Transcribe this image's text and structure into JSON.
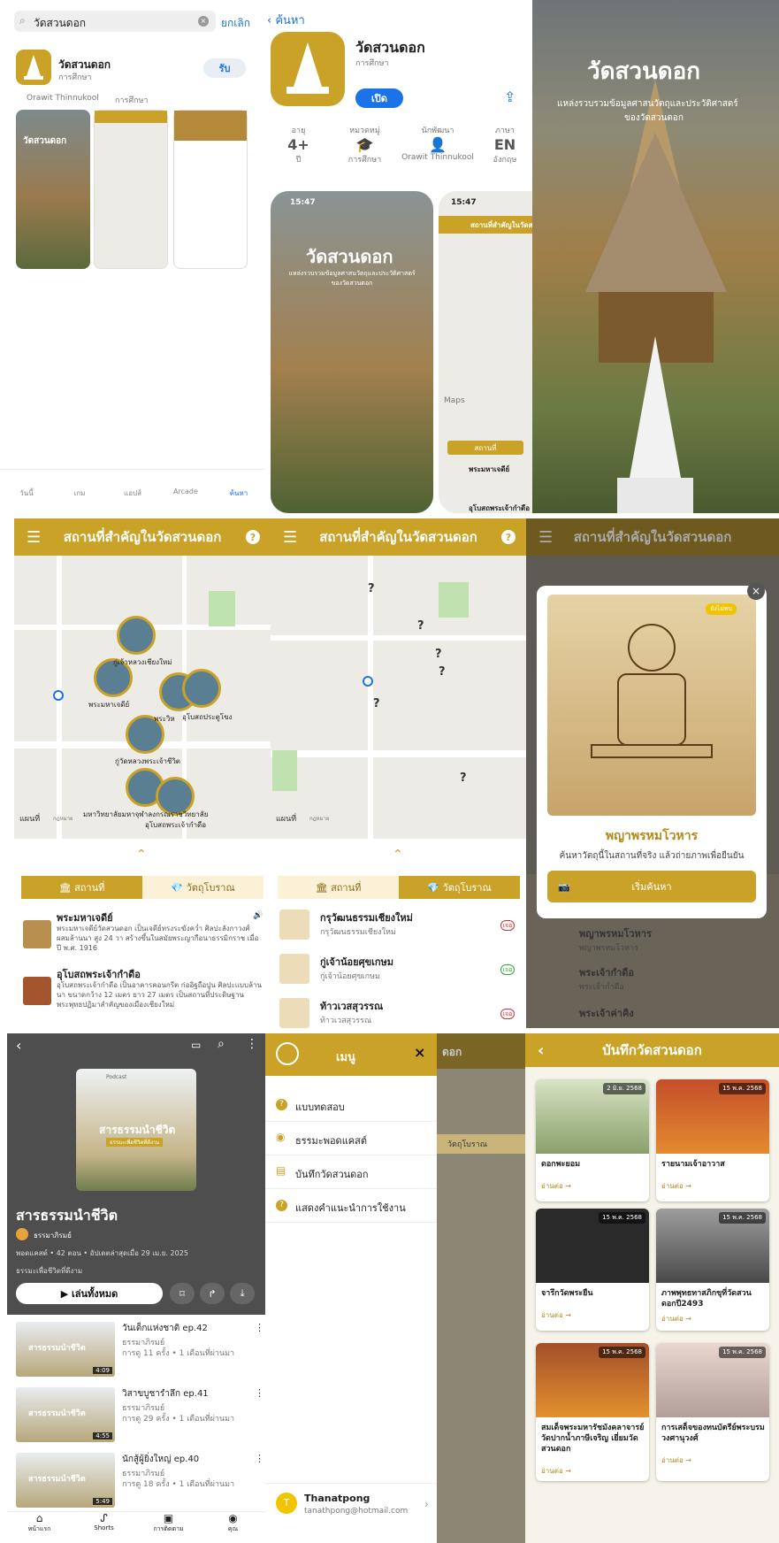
{
  "colors": {
    "gold": "#c9a227",
    "blue": "#1a73e8"
  },
  "p1": {
    "search_value": "วัดสวนดอก",
    "cancel": "ยกเลิก",
    "app_name": "วัดสวนดอก",
    "app_cat": "การศึกษา",
    "get": "รับ",
    "developer": "Orawit Thinnukool",
    "dev_cat": "การศึกษา",
    "tabs": [
      "วันนี้",
      "เกม",
      "แอปส์",
      "Arcade",
      "ค้นหา"
    ],
    "shot1_title": "วัดสวนดอก"
  },
  "p2": {
    "back": "ค้นหา",
    "app_name": "วัดสวนดอก",
    "app_cat": "การศึกษา",
    "open": "เปิด",
    "info": [
      {
        "h": "อายุ",
        "v": "4+",
        "s": "ปี"
      },
      {
        "h": "หมวดหมู่",
        "v": "",
        "s": "การศึกษา"
      },
      {
        "h": "นักพัฒนา",
        "v": "",
        "s": "Orawit Thinnukool"
      },
      {
        "h": "ภาษา",
        "v": "EN",
        "s": "อังกฤษ"
      }
    ],
    "time1": "15:47",
    "time2": "15:47",
    "shot_title": "วัดสวนดอก",
    "shot_sub": "แหล่งรวบรวมข้อมูลศาสนวัตถุและประวัติศาสตร์ของวัดสวนดอก",
    "hdr": "สถานที่สำคัญในวัดสวนดอก",
    "btn": "สถานที่",
    "item": "พระมหาเจดีย์",
    "item2": "อุโบสถพระเจ้ากำดือ",
    "maps": "Maps"
  },
  "p3": {
    "title": "วัดสวนดอก",
    "sub1": "แหล่งรวบรวมข้อมูลศาสนวัตถุและประวัติศาสตร์",
    "sub2": "ของวัดสวนดอก"
  },
  "p4": {
    "hdr": "สถานที่สำคัญในวัดสวนดอก",
    "maps": "แผนที่",
    "legal": "กฎหมาย",
    "labels": [
      "กู่เจ้าหลวงเชียงใหม่",
      "พระมหาเจดีย์",
      "พระวิห",
      "อุโบสถประตูโขง",
      "กู่วัดหลวงพระเจ้าชีวิต",
      "มหาวิทยาลัยมหาจุฬาลงกรณราชวิทยาลัย",
      "อุโบสถพระเจ้ากำดือ"
    ],
    "tab1": "สถานที่",
    "tab2": "วัตถุโบราณ",
    "items": [
      {
        "t": "พระมหาเจดีย์",
        "d": "พระมหาเจดีย์วัดสวนดอก เป็นเจดีย์ทรงระฆังคว่ำ ศิลปะลังกาวงศ์ผสมล้านนา สูง 24 วา สร้างขึ้นในสมัยพระญากือนาธรรมิกราช เมื่อปี พ.ศ. 1916"
      },
      {
        "t": "อุโบสถพระเจ้ากำดือ",
        "d": "อุโบสถพระเจ้ากำดือ เป็นอาคารคอนกรีต ก่ออิฐถือปูน ศิลปะแบบล้านนา ขนาดกว้าง 12 เมตร ยาว 27 เมตร เป็นสถานที่ประดิษฐานพระพุทธปฏิมาสำคัญของเมืองเชียงใหม่"
      }
    ]
  },
  "p5": {
    "hdr": "สถานที่สำคัญในวัดสวนดอก",
    "maps": "แผนที่",
    "legal": "กฎหมาย",
    "tab1": "สถานที่",
    "tab2": "วัตถุโบราณ",
    "items": [
      {
        "t": "กรุวัฒนธรรมเชียงใหม่",
        "s": "กรุวัฒนธรรมเชียงใหม่",
        "b": "เจอ"
      },
      {
        "t": "กู่เจ้าน้อยศุขเกษม",
        "s": "กู่เจ้าน้อยศุขเกษม",
        "b": "เจอ"
      },
      {
        "t": "ท้าวเวสสุวรรณ",
        "s": "ท้าวเวสสุวรรณ",
        "b": "เจอ"
      }
    ]
  },
  "p6": {
    "hdr": "สถานที่สำคัญในวัดสวนดอก",
    "tag": "ยังไม่พบ",
    "name": "พญาพรหมโวหาร",
    "hint": "ค้นหาวัตถุนี้ในสถานที่จริง แล้วถ่ายภาพเพื่อยืนยัน",
    "start": "เริ่มค้นหา",
    "rows": [
      {
        "t": "พญาพรหมโวหาร",
        "s": "พญาพรหมโวหาร"
      },
      {
        "t": "พระเจ้ากำดือ",
        "s": "พระเจ้ากำดือ"
      },
      {
        "t": "พระเจ้าค่าคิง",
        "s": ""
      }
    ]
  },
  "p7": {
    "cover_brand": "Podcast",
    "cover_title": "สารธรรมนำชีวิต",
    "cover_sub": "ธรรมะเพื่อชีวิตที่ดีงาม",
    "title": "สารธรรมนำชีวิต",
    "channel": "ธรรมาภิรมย์",
    "meta": "พอดแคสต์ • 42 ตอน • อัปเดตล่าสุดเมื่อ 29 เม.ย. 2025",
    "desc": "ธรรมะเพื่อชีวิตที่ดีงาม",
    "play": "เล่นทั้งหมด",
    "eps": [
      {
        "t": "วันเด็กแห่งชาติ ep.42",
        "c": "ธรรมาภิรมย์",
        "m": "การดู 11 ครั้ง • 1 เดือนที่ผ่านมา",
        "d": "4:09",
        "th": "สารธรรมนำชีวิต"
      },
      {
        "t": "วิสาขบูชารำลึก ep.41",
        "c": "ธรรมาภิรมย์",
        "m": "การดู 29 ครั้ง • 1 เดือนที่ผ่านมา",
        "d": "4:55",
        "th": "สารธรรมนำชีวิต"
      },
      {
        "t": "นักสู้ผู้ยิ่งใหญ่ ep.40",
        "c": "ธรรมาภิรมย์",
        "m": "การดู 18 ครั้ง • 1 เดือนที่ผ่านมา",
        "d": "5:49",
        "th": "สารธรรมนำชีวิต"
      }
    ],
    "nav": [
      "หน้าแรก",
      "Shorts",
      "การติดตาม",
      "คุณ"
    ]
  },
  "p8": {
    "menu": "เมนู",
    "items": [
      "แบบทดสอบ",
      "ธรรมะพอดแคสต์",
      "บันทึกวัดสวนดอก",
      "แสดงคำแนะนำการใช้งาน"
    ],
    "bg_hdr": "ดอก",
    "bg_tab": "วัตถุโบราณ",
    "user": "Thanatpong",
    "email": "tanathpong@hotmail.com",
    "avatar": "T"
  },
  "p9": {
    "hdr": "บันทึกวัดสวนดอก",
    "more": "อ่านต่อ →",
    "cards": [
      {
        "t": "ดอกพะยอม",
        "d": "2 มิ.ย. 2568"
      },
      {
        "t": "รายนามเจ้าอาวาส",
        "d": "15 พ.ค. 2568"
      },
      {
        "t": "จารึกวัดพระยืน",
        "d": "15 พ.ค. 2568"
      },
      {
        "t": "ภาพพุทธทาสภิกขุที่วัดสวนดอกปี2493",
        "d": "15 พ.ค. 2568"
      },
      {
        "t": "สมเด็จพระมหารัชมังคลาจารย์ วัดปากน้ำภาษีเจริญ เยี่ยมวัดสวนดอก",
        "d": "15 พ.ค. 2568"
      },
      {
        "t": "การเสด็จของทนบัตรีย์พระบรมวงศานุวงศ์",
        "d": "15 พ.ค. 2568"
      }
    ]
  }
}
